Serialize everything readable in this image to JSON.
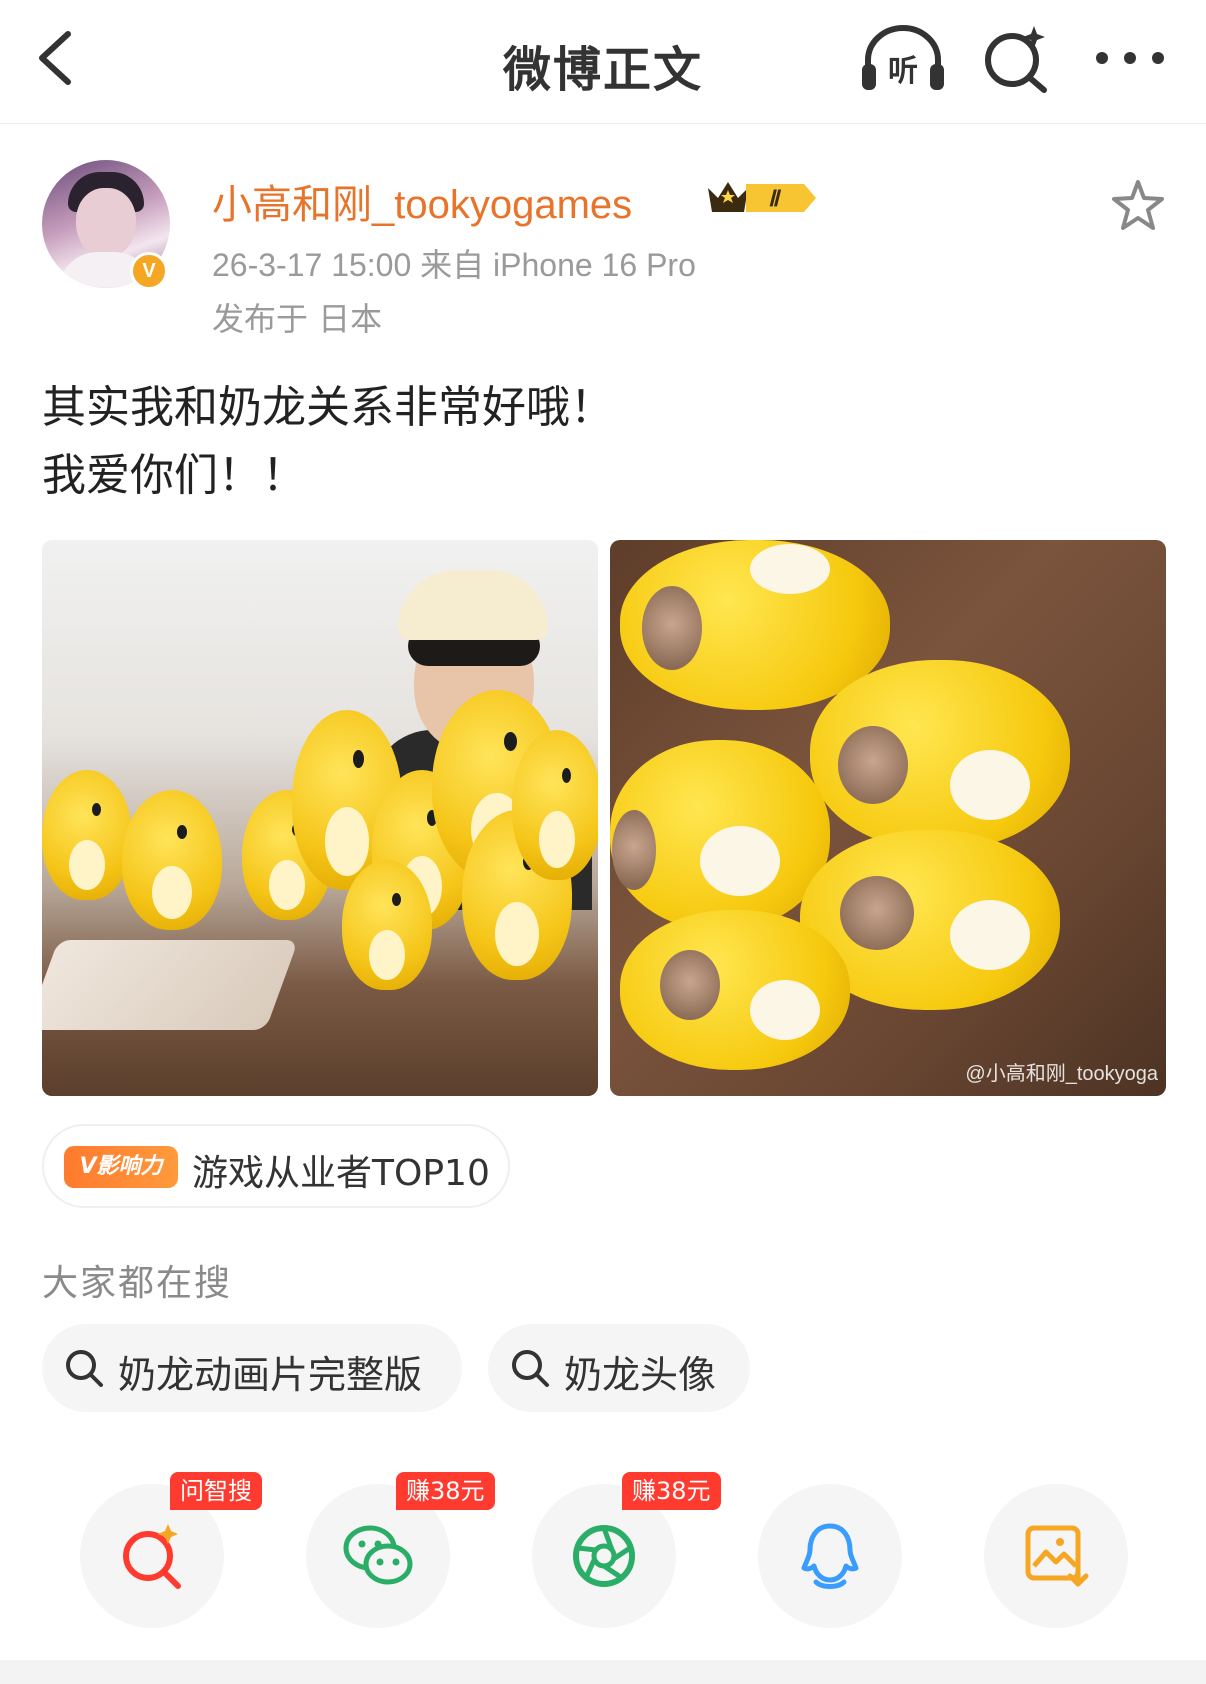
{
  "header": {
    "title": "微博正文",
    "listen_label": "听",
    "icons": {
      "back": "chevron-left-icon",
      "listen": "headphones-icon",
      "search": "ai-search-icon",
      "more": "more-dots-icon"
    }
  },
  "post": {
    "username": "小高和刚_tookyogames",
    "vip_level": "Ⅱ",
    "verified_mark": "V",
    "meta": "26-3-17 15:00  来自 iPhone 16 Pro",
    "location": "发布于 日本",
    "text_line1": "其实我和奶龙关系非常好哦！",
    "text_line2": "我爱你们！！",
    "photo_watermark": "@小高和刚_tookyoga",
    "colors": {
      "username": "#e8732a",
      "verified": "#f5a623"
    }
  },
  "influence": {
    "badge": "V影响力",
    "text": "游戏从业者TOP10"
  },
  "search": {
    "title": "大家都在搜",
    "items": [
      "奶龙动画片完整版",
      "奶龙头像"
    ]
  },
  "share": {
    "items": [
      {
        "icon": "ai-search-icon",
        "tag": "问智搜"
      },
      {
        "icon": "wechat-icon",
        "tag": "赚38元"
      },
      {
        "icon": "moments-icon",
        "tag": "赚38元"
      },
      {
        "icon": "qq-icon",
        "tag": ""
      },
      {
        "icon": "save-image-icon",
        "tag": ""
      }
    ],
    "colors": {
      "tag": "#ff3b30",
      "wechat": "#2aae67",
      "qq": "#3a9cff",
      "save": "#f5a623",
      "search": "#ff3b30"
    }
  }
}
